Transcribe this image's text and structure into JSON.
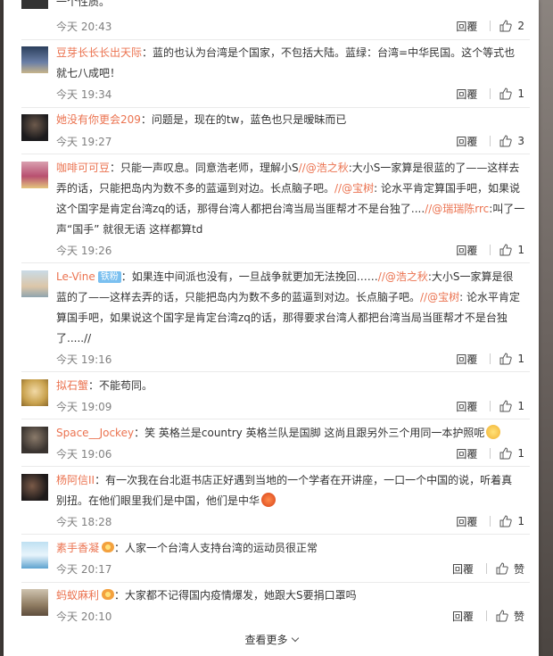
{
  "more": {
    "label": "查看更多"
  },
  "top": {
    "text_tail": "一个性质。",
    "time": "今天 20:43",
    "reply": "回覆",
    "likes": "2"
  },
  "comments": [
    {
      "user": "豆芽长长长出天际",
      "text1": "：蓝的也认为台湾是个国家，不包括大陆。蓝绿：台湾=中华民国。这个等式也",
      "text2": "就七八成吧！",
      "time": "今天 19:34",
      "reply": "回覆",
      "likes": "1"
    },
    {
      "user": "她没有你更会209",
      "text1": "：问题是，现在的tw，蓝色也只是暧昧而已",
      "time": "今天 19:27",
      "reply": "回覆",
      "likes": "3"
    },
    {
      "user": "咖啡可可豆",
      "text1a": "：只能一声叹息。同意浩老师，理解小S",
      "m1": "//@浩之秋",
      "text1b": ":大小S一家算是很蓝的了——这样去",
      "text2a": "弄的话，只能把岛内为数不多的蓝逼到对边。长点脑子吧。",
      "m2": "//@宝树",
      "text2b": ": 论水平肯定算国手吧，如果说",
      "text3a": "这个国字是肯定台湾zq的话，那得台湾人都把台湾当局当匪帮才不是台独了....",
      "m3": "//@瑞瑞陈rrc",
      "text3b": ":叫了一",
      "text4": "声“国手” 就很无语 这样都算td",
      "time": "今天 19:26",
      "reply": "回覆",
      "likes": "1"
    },
    {
      "user": "Le-Vine",
      "badge": "铁粉",
      "text1a": "：如果连中间派也没有，一旦战争就更加无法挽回……",
      "m1": "//@浩之秋",
      "text1b": ":大小S一家算是很",
      "text2": "蓝的了——这样去弄的话，只能把岛内为数不多的蓝逼到对边。长点脑子吧。",
      "m2": "//@宝树",
      "text2b": ": 论水平肯定",
      "text3": "算国手吧，如果说这个国字是肯定台湾zq的话，那得要求台湾人都把台湾当局当匪帮才不是台独",
      "text4": "了.....//",
      "time": "今天 19:16",
      "reply": "回覆",
      "likes": "1"
    },
    {
      "user": "拟石蟹",
      "text1": "：不能苟同。",
      "time": "今天 19:09",
      "reply": "回覆",
      "likes": "1"
    },
    {
      "user": "Space__Jockey",
      "text1": "：笑 英格兰是country 英格兰队是国脚 这尚且跟另外三个用同一本护照呢",
      "time": "今天 19:06",
      "reply": "回覆",
      "likes": "1"
    },
    {
      "user": "杨阿信II",
      "text1": "：有一次我在台北逛书店正好遇到当地的一个学者在开讲座，一口一个中国的说，听着真",
      "text2": "别扭。在他们眼里我们是中国，他们是中华",
      "time": "今天 18:28",
      "reply": "回覆",
      "likes": "1"
    },
    {
      "user": "素手香凝",
      "text1": "：人家一个台湾人支持台湾的运动员很正常",
      "time": "今天 20:17",
      "reply": "回覆",
      "likes": "赞"
    },
    {
      "user": "蚂蚁麻利",
      "text1": "：大家都不记得国内疫情爆发，她跟大S要捐口罩吗",
      "time": "今天 20:10",
      "reply": "回覆",
      "likes": "赞"
    }
  ],
  "colors": {
    "link": "#eb7350",
    "text": "#333333",
    "meta": "#808080"
  }
}
